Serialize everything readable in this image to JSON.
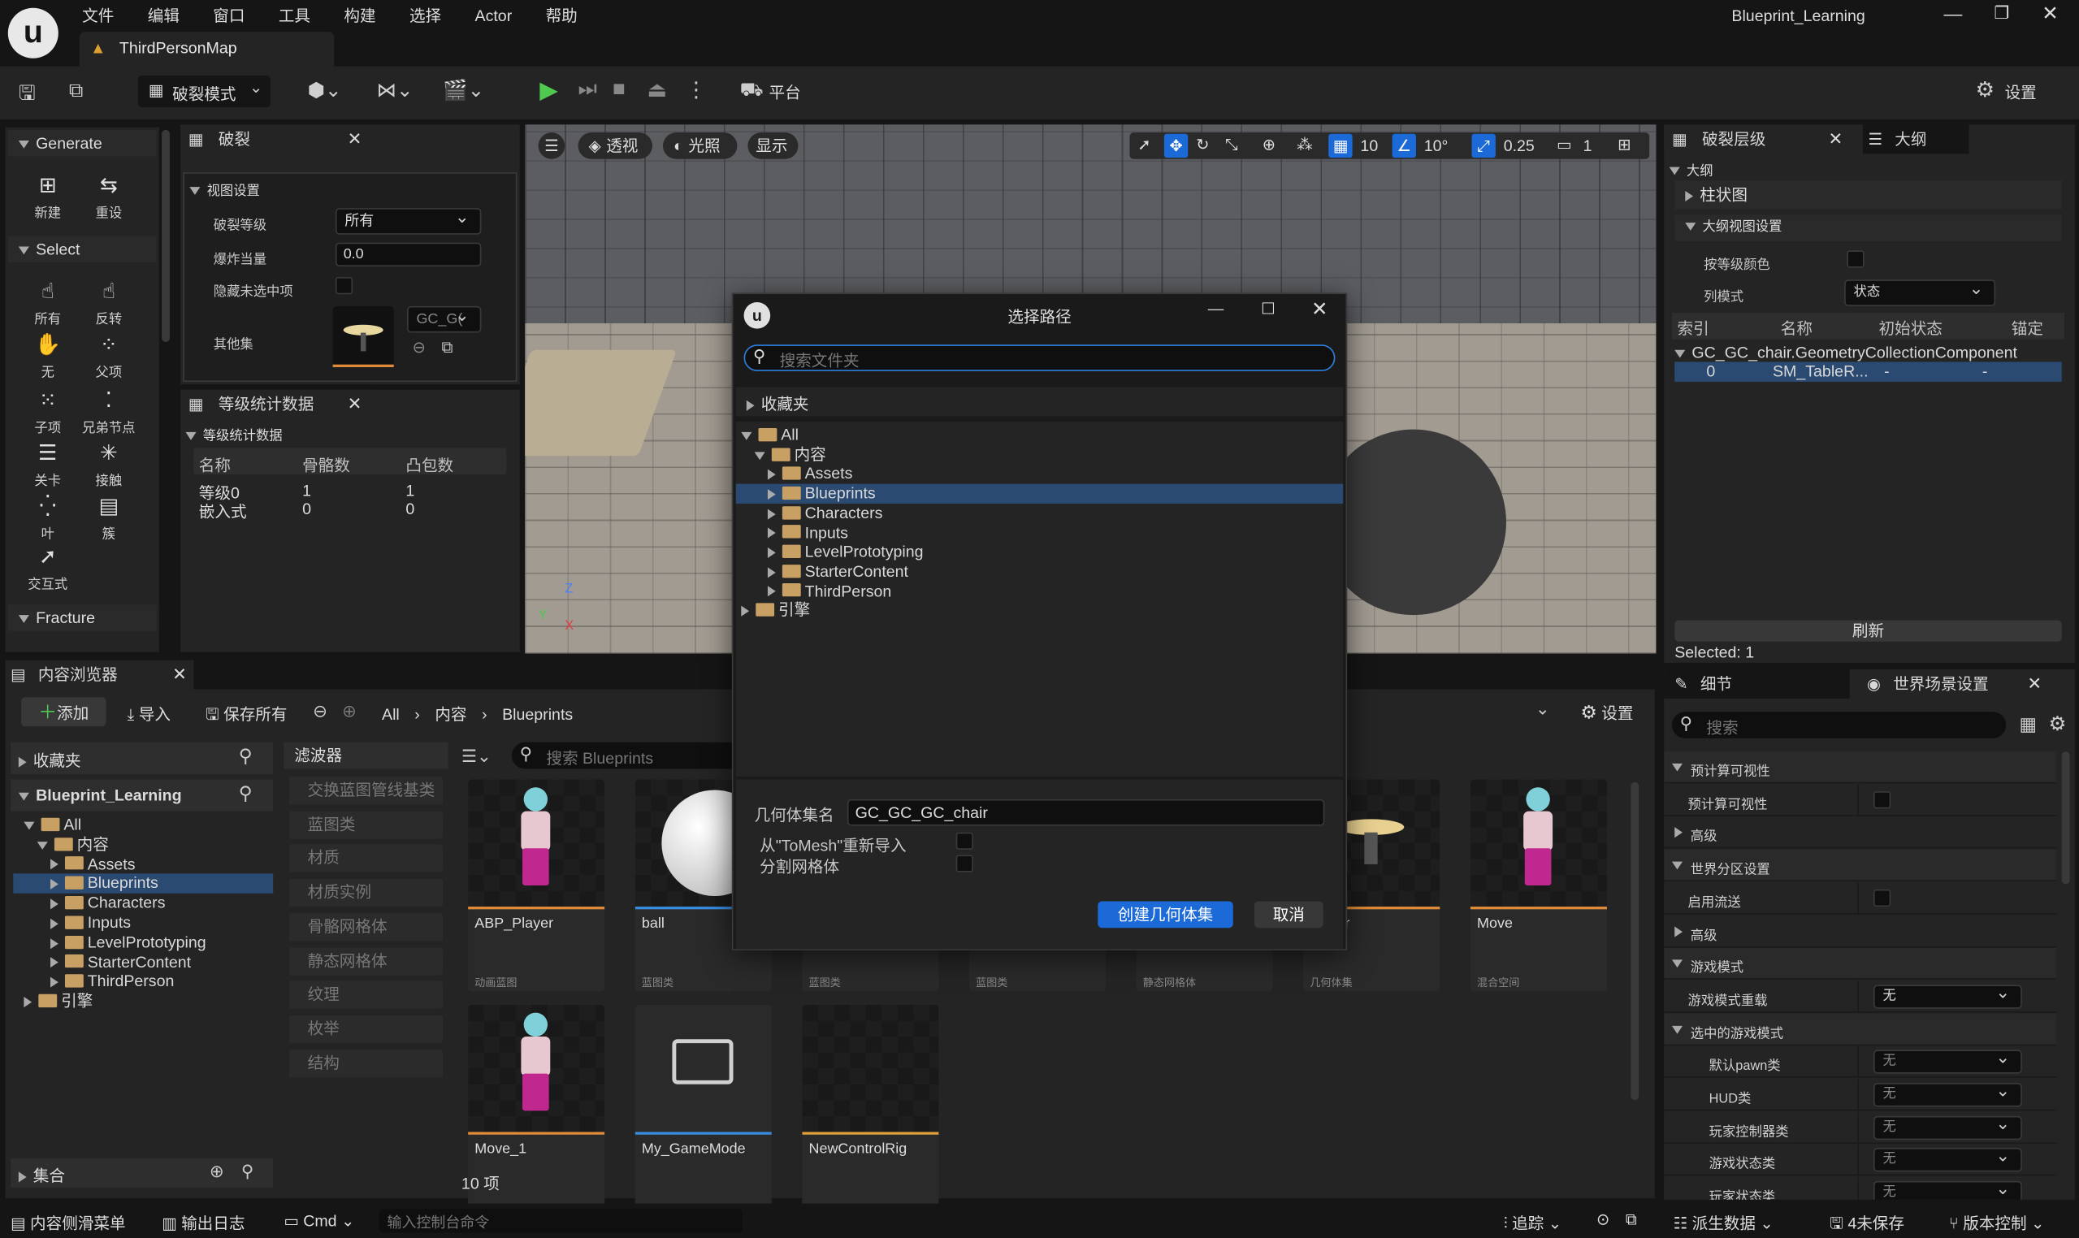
{
  "menu": [
    "文件",
    "编辑",
    "窗口",
    "工具",
    "构建",
    "选择",
    "Actor",
    "帮助"
  ],
  "project_title": "Blueprint_Learning",
  "map_tab": "ThirdPersonMap",
  "toolbar": {
    "mode": "破裂模式",
    "platform": "平台",
    "settings": "设置"
  },
  "fracture_tools": {
    "generate": "Generate",
    "new": "新建",
    "reset": "重设",
    "select": "Select",
    "all": "所有",
    "invert": "反转",
    "none": "无",
    "parent": "父项",
    "child": "子项",
    "siblings": "兄弟节点",
    "level": "关卡",
    "contact": "接触",
    "leaf": "叶",
    "cluster": "簇",
    "interactive": "交互式",
    "fracture": "Fracture"
  },
  "fracture_panel": {
    "tab": "破裂",
    "section": "视图设置",
    "level_label": "破裂等级",
    "level_value": "所有",
    "explode_label": "爆炸当量",
    "explode_value": "0.0",
    "hide_label": "隐藏未选中项",
    "other_label": "其他集",
    "other_value": "GC_G("
  },
  "stats_panel": {
    "tab": "等级统计数据",
    "section": "等级统计数据",
    "headers": [
      "名称",
      "骨骼数",
      "凸包数"
    ],
    "rows": [
      [
        "等级0",
        "1",
        "1"
      ],
      [
        "嵌入式",
        "0",
        "0"
      ]
    ]
  },
  "viewport": {
    "perspective": "透视",
    "lit": "光照",
    "show": "显示",
    "grid": "10",
    "angle": "10°",
    "scale": "0.25",
    "cam": "1"
  },
  "dialog": {
    "title": "选择路径",
    "search_placeholder": "搜索文件夹",
    "favorites": "收藏夹",
    "tree": [
      "All",
      "内容",
      "Assets",
      "Blueprints",
      "Characters",
      "Inputs",
      "LevelPrototyping",
      "StarterContent",
      "ThirdPerson",
      "引擎"
    ],
    "name_label": "几何体集名",
    "name_value": "GC_GC_GC_chair",
    "reimport_label": "从\"ToMesh\"重新导入",
    "split_label": "分割网格体",
    "create_button": "创建几何体集",
    "cancel_button": "取消"
  },
  "outliner": {
    "tab1": "破裂层级",
    "tab2": "大纲",
    "section": "大纲",
    "histogram": "柱状图",
    "view_settings": "大纲视图设置",
    "color_label": "按等级颜色",
    "column_label": "列模式",
    "column_value": "状态",
    "headers": [
      "索引",
      "名称",
      "初始状态",
      "锚定"
    ],
    "component": "GC_GC_chair.GeometryCollectionComponent",
    "row": [
      "0",
      "SM_TableR...",
      "-",
      "-"
    ],
    "refresh": "刷新",
    "selected": "Selected: 1"
  },
  "details": {
    "tab1": "细节",
    "tab2": "世界场景设置",
    "search_placeholder": "搜索",
    "rows": [
      {
        "t": "sec",
        "l": "预计算可视性"
      },
      {
        "t": "chk",
        "l": "预计算可视性"
      },
      {
        "t": "col",
        "l": "高级"
      },
      {
        "t": "sec",
        "l": "世界分区设置"
      },
      {
        "t": "chk",
        "l": "启用流送"
      },
      {
        "t": "col",
        "l": "高级"
      },
      {
        "t": "sec",
        "l": "游戏模式"
      },
      {
        "t": "dd",
        "l": "游戏模式重载",
        "v": "无"
      },
      {
        "t": "sec",
        "l": "选中的游戏模式"
      },
      {
        "t": "dd2",
        "l": "默认pawn类",
        "v": "无"
      },
      {
        "t": "dd2",
        "l": "HUD类",
        "v": "无"
      },
      {
        "t": "dd2",
        "l": "玩家控制器类",
        "v": "无"
      },
      {
        "t": "dd2",
        "l": "游戏状态类",
        "v": "无"
      },
      {
        "t": "dd2",
        "l": "玩家状态类",
        "v": "无"
      }
    ]
  },
  "content_browser": {
    "tab": "内容浏览器",
    "add": "添加",
    "import": "导入",
    "save_all": "保存所有",
    "path": [
      "All",
      "内容",
      "Blueprints"
    ],
    "settings": "设置",
    "favorites": "收藏夹",
    "project": "Blueprint_Learning",
    "tree": [
      "All",
      "内容",
      "Assets",
      "Blueprints",
      "Characters",
      "Inputs",
      "LevelPrototyping",
      "StarterContent",
      "ThirdPerson",
      "引擎"
    ],
    "collections": "集合",
    "filters_title": "滤波器",
    "filters": [
      "交换蓝图管线基类",
      "蓝图类",
      "材质",
      "材质实例",
      "骨骼网格体",
      "静态网格体",
      "纹理",
      "枚举",
      "结构"
    ],
    "search_placeholder": "搜索 Blueprints",
    "count": "10 项",
    "assets": [
      {
        "name": "ABP_Player",
        "type": "动画蓝图",
        "color": "#e08c3a"
      },
      {
        "name": "ball",
        "type": "蓝图类",
        "color": "#3a8ce0"
      },
      {
        "name": "",
        "type": "蓝图类",
        "color": "#3a8ce0"
      },
      {
        "name": "",
        "type": "蓝图类",
        "color": "#3a8ce0"
      },
      {
        "name": "",
        "type": "静态网格体",
        "color": "#3ac0e0"
      },
      {
        "name": "_chair",
        "type": "几何体集",
        "color": "#e08c3a"
      },
      {
        "name": "Move",
        "type": "混合空间",
        "color": "#e08c3a"
      },
      {
        "name": "Move_1",
        "type": "",
        "color": "#e08c3a"
      },
      {
        "name": "My_GameMode",
        "type": "",
        "color": "#3a8ce0"
      },
      {
        "name": "NewControlRig",
        "type": "",
        "color": "#e0a03a"
      }
    ]
  },
  "statusbar": {
    "drawer": "内容侧滑菜单",
    "log": "输出日志",
    "cmd": "Cmd",
    "cmd_placeholder": "输入控制台命令",
    "trace": "追踪",
    "derived": "派生数据",
    "unsaved": "4未保存",
    "source": "版本控制"
  }
}
